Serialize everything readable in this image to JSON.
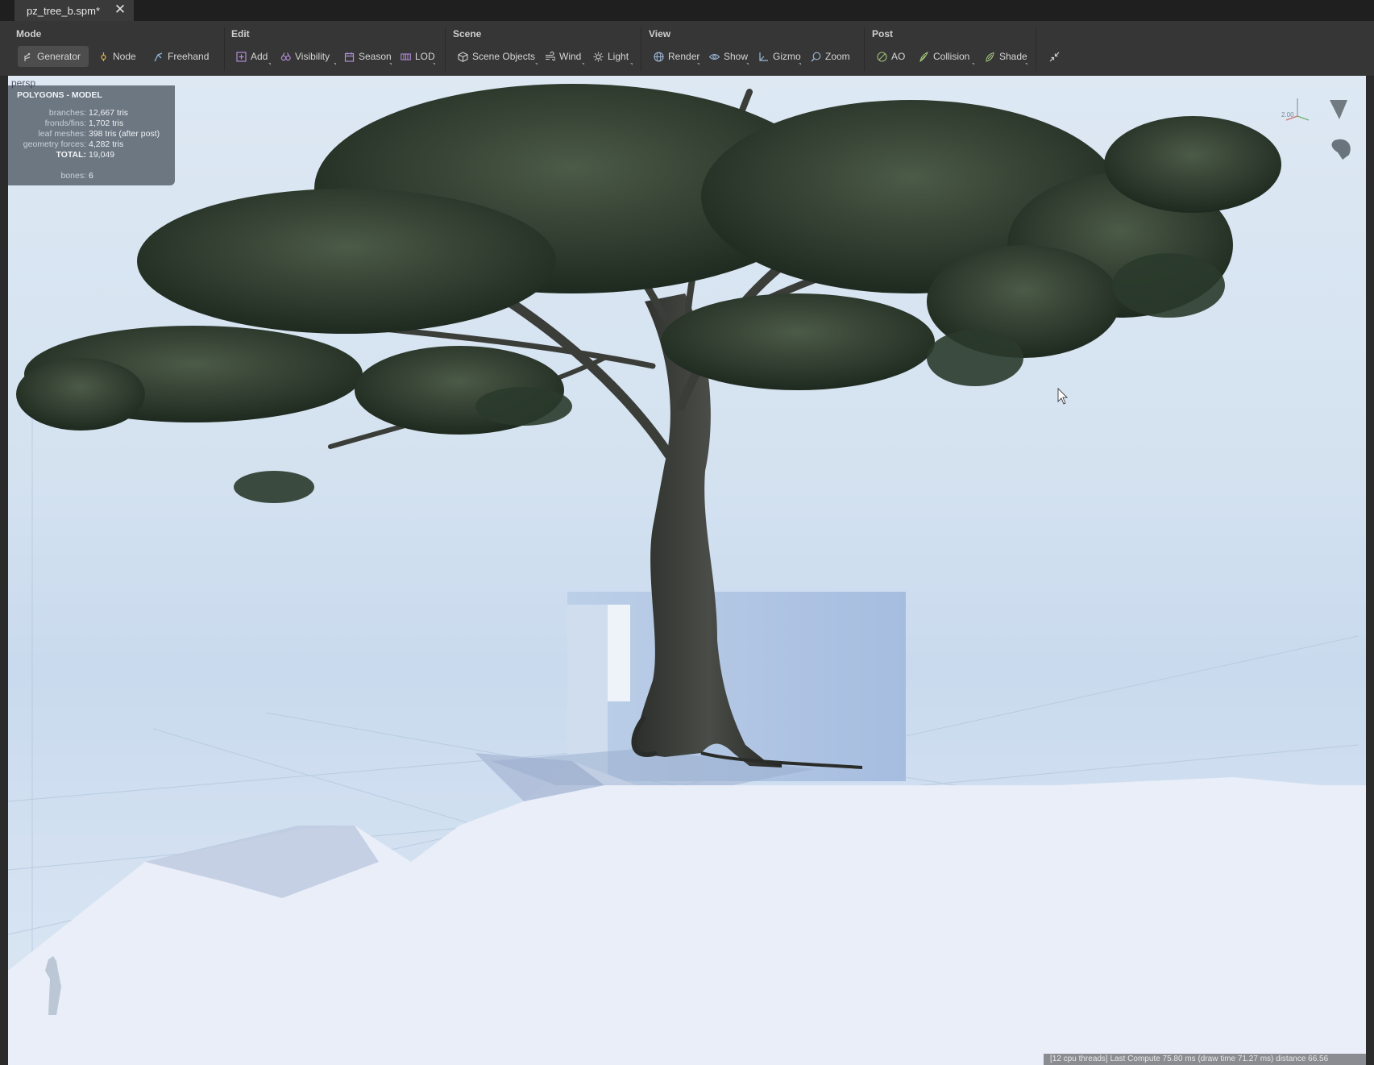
{
  "tab": {
    "title": "pz_tree_b.spm*",
    "close_icon": "close-icon"
  },
  "toolbar": {
    "mode": {
      "title": "Mode",
      "buttons": [
        {
          "label": "Generator",
          "icon": "generator-icon",
          "active": true
        },
        {
          "label": "Node",
          "icon": "node-icon"
        },
        {
          "label": "Freehand",
          "icon": "freehand-icon"
        }
      ]
    },
    "edit": {
      "title": "Edit",
      "buttons": [
        {
          "label": "Add",
          "icon": "add-icon"
        },
        {
          "label": "Visibility",
          "icon": "visibility-icon"
        },
        {
          "label": "Season",
          "icon": "season-icon"
        },
        {
          "label": "LOD",
          "icon": "lod-icon"
        }
      ]
    },
    "scene": {
      "title": "Scene",
      "buttons": [
        {
          "label": "Scene Objects",
          "icon": "cube-icon"
        },
        {
          "label": "Wind",
          "icon": "wind-icon"
        },
        {
          "label": "Light",
          "icon": "light-icon"
        }
      ]
    },
    "view": {
      "title": "View",
      "buttons": [
        {
          "label": "Render",
          "icon": "globe-icon"
        },
        {
          "label": "Show",
          "icon": "eye-icon"
        },
        {
          "label": "Gizmo",
          "icon": "gizmo-icon"
        },
        {
          "label": "Zoom",
          "icon": "zoom-icon"
        }
      ]
    },
    "post": {
      "title": "Post",
      "buttons": [
        {
          "label": "AO",
          "icon": "ao-icon"
        },
        {
          "label": "Collision",
          "icon": "collision-icon"
        },
        {
          "label": "Shade",
          "icon": "shade-icon"
        }
      ]
    },
    "collapse_icon": "collapse-icon"
  },
  "viewport": {
    "label": "persp",
    "stats": {
      "title": "POLYGONS - MODEL",
      "rows": [
        {
          "key": "branches:",
          "value": "12,667 tris"
        },
        {
          "key": "fronds/fins:",
          "value": "1,702 tris"
        },
        {
          "key": "leaf meshes:",
          "value": "398 tris (after post)"
        },
        {
          "key": "geometry forces:",
          "value": "4,282 tris"
        },
        {
          "key": "TOTAL:",
          "value": "19,049"
        },
        {
          "key": "bones:",
          "value": "6"
        }
      ]
    },
    "gizmo_value": "2.00",
    "status": "[12 cpu threads]  Last Compute 75.80 ms (draw time 71.27 ms)  distance 66.56"
  }
}
